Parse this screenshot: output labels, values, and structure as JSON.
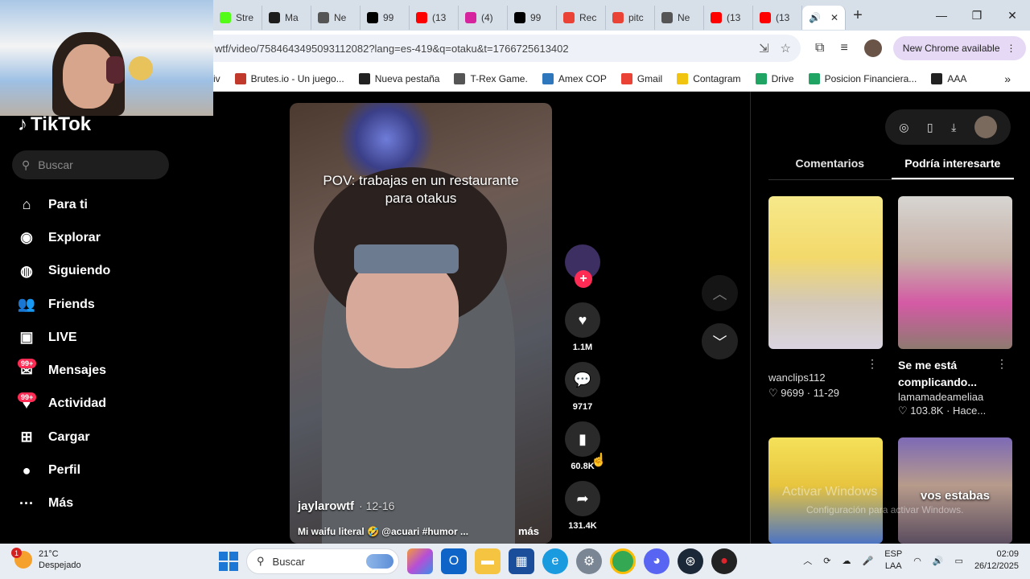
{
  "browser": {
    "tabs": [
      {
        "label": "Stre",
        "icon": "kick-icon",
        "color": "#53fc18"
      },
      {
        "label": "Ma",
        "icon": "bolt-icon",
        "color": "#1d1d1d"
      },
      {
        "label": "Ne",
        "icon": "chrome-icon",
        "color": "#555555"
      },
      {
        "label": "99",
        "icon": "tiktok-icon",
        "color": "#000000"
      },
      {
        "label": "(13",
        "icon": "youtube-icon",
        "color": "#ff0000"
      },
      {
        "label": "(4)",
        "icon": "instagram-icon",
        "color": "#d6249f"
      },
      {
        "label": "99",
        "icon": "tiktok-icon",
        "color": "#000000"
      },
      {
        "label": "Rec",
        "icon": "gmail-icon",
        "color": "#ea4335"
      },
      {
        "label": "pitc",
        "icon": "gmail-icon",
        "color": "#ea4335"
      },
      {
        "label": "Ne",
        "icon": "chrome-icon",
        "color": "#555555"
      },
      {
        "label": "(13",
        "icon": "youtube-icon",
        "color": "#ff0000"
      },
      {
        "label": "(13",
        "icon": "youtube-icon",
        "color": "#ff0000"
      }
    ],
    "url": "wtf/video/7584643495093112082?lang=es-419&q=otaku&t=1766725613402",
    "new_chrome": "New Chrome available",
    "bookmarks": [
      {
        "label": "iv",
        "icon": "",
        "color": ""
      },
      {
        "label": "Brutes.io - Un juego...",
        "icon": "brutes-icon",
        "color": "#c0392b"
      },
      {
        "label": "Nueva pestaña",
        "icon": "chrome-icon",
        "color": "#222222"
      },
      {
        "label": "T-Rex Game.",
        "icon": "dino-icon",
        "color": "#555555"
      },
      {
        "label": "Amex COP",
        "icon": "amex-icon",
        "color": "#2e77bc"
      },
      {
        "label": "Gmail",
        "icon": "gmail-icon",
        "color": "#ea4335"
      },
      {
        "label": "Contagram",
        "icon": "contagram-icon",
        "color": "#f1c40f"
      },
      {
        "label": "Drive",
        "icon": "drive-icon",
        "color": "#1fa463"
      },
      {
        "label": "Posicion Financiera...",
        "icon": "drive-icon",
        "color": "#1fa463"
      },
      {
        "label": "AAA",
        "icon": "aaa-icon",
        "color": "#222222"
      }
    ]
  },
  "tiktok": {
    "logo": "TikTok",
    "search_placeholder": "Buscar",
    "nav": [
      {
        "label": "Para ti",
        "icon": "home-icon"
      },
      {
        "label": "Explorar",
        "icon": "compass-icon"
      },
      {
        "label": "Siguiendo",
        "icon": "following-avatar-icon"
      },
      {
        "label": "Friends",
        "icon": "friends-icon"
      },
      {
        "label": "LIVE",
        "icon": "live-icon"
      },
      {
        "label": "Mensajes",
        "icon": "messages-icon",
        "badge": "99+"
      },
      {
        "label": "Actividad",
        "icon": "activity-icon",
        "badge": "99+"
      },
      {
        "label": "Cargar",
        "icon": "upload-icon"
      },
      {
        "label": "Perfil",
        "icon": "profile-avatar-icon"
      },
      {
        "label": "Más",
        "icon": "more-icon"
      }
    ],
    "video": {
      "caption_line1": "POV: trabajas en un restaurante",
      "caption_line2": "para otakus",
      "author": "jaylarowtf",
      "date": "· 12-16",
      "description": "Mi waifu literal 🤣 @acuari #humor ...",
      "more": "más"
    },
    "actions": {
      "likes": "1.1M",
      "comments": "9717",
      "saves": "60.8K",
      "shares": "131.4K"
    },
    "panel": {
      "tabs": [
        "Comentarios",
        "Podría interesarte"
      ],
      "active_tab": 1,
      "cards": [
        {
          "title": "",
          "user": "wanclips112",
          "stats": "♡ 9699 · 11-29",
          "thumb_text": ""
        },
        {
          "title": "Se me está complicando...",
          "user": "lamamadeameliaa",
          "stats": "♡ 103.8K · Hace...",
          "thumb_text": ""
        },
        {
          "title": "",
          "user": "",
          "stats": "",
          "thumb_text": ""
        },
        {
          "title": "",
          "user": "",
          "stats": "",
          "thumb_text": "vos estabas"
        }
      ]
    }
  },
  "windows_watermark": {
    "line1": "Activar Windows",
    "line2": "Configuración para activar Windows."
  },
  "taskbar": {
    "temperature": "21°C",
    "weather": "Despejado",
    "weather_badge": "1",
    "search": "Buscar",
    "lang_line1": "ESP",
    "lang_line2": "LAA",
    "time": "02:09",
    "date": "26/12/2025"
  }
}
